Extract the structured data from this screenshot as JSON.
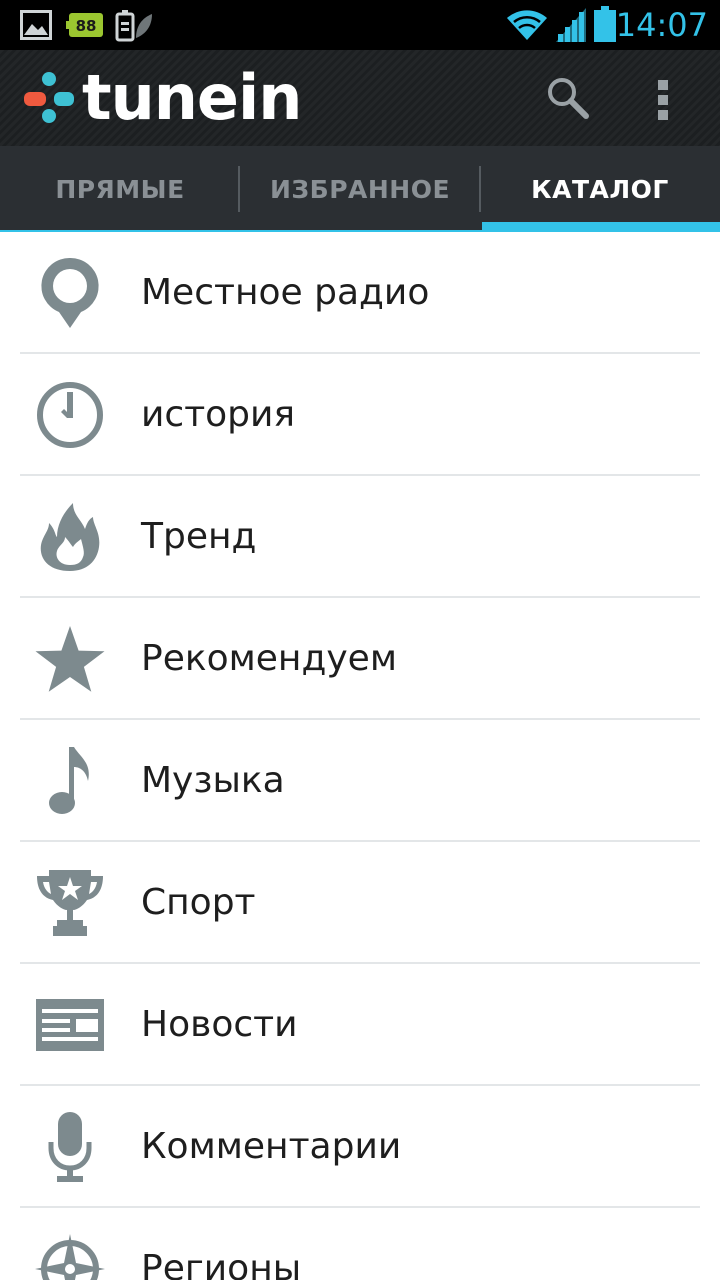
{
  "status_bar": {
    "battery_badge": "88",
    "clock": "14:07",
    "icons": [
      "gallery-notification-icon",
      "battery-notification-icon",
      "eco-battery-icon",
      "wifi-icon",
      "signal-icon",
      "battery-icon"
    ]
  },
  "action_bar": {
    "brand": "tunein",
    "actions": [
      "search-icon",
      "overflow-menu-icon"
    ]
  },
  "tabs": [
    {
      "label": "ПРЯМЫЕ",
      "active": false
    },
    {
      "label": "ИЗБРАННОЕ",
      "active": false
    },
    {
      "label": "КАТАЛОГ",
      "active": true
    }
  ],
  "catalog": [
    {
      "label": "Местное радио",
      "icon": "location-pin-icon"
    },
    {
      "label": "история",
      "icon": "clock-icon"
    },
    {
      "label": "Тренд",
      "icon": "flame-icon"
    },
    {
      "label": "Рекомендуем",
      "icon": "star-icon"
    },
    {
      "label": "Музыка",
      "icon": "music-note-icon"
    },
    {
      "label": "Спорт",
      "icon": "trophy-icon"
    },
    {
      "label": "Новости",
      "icon": "newspaper-icon"
    },
    {
      "label": "Комментарии",
      "icon": "microphone-icon"
    },
    {
      "label": "Регионы",
      "icon": "compass-icon"
    }
  ],
  "colors": {
    "accent": "#33c2e8",
    "icon_gray": "#7d8a8e",
    "action_bar": "#222527",
    "tab_bar": "#2b2f33",
    "logo_red": "#f05a3f",
    "logo_teal": "#3ec1d3"
  }
}
